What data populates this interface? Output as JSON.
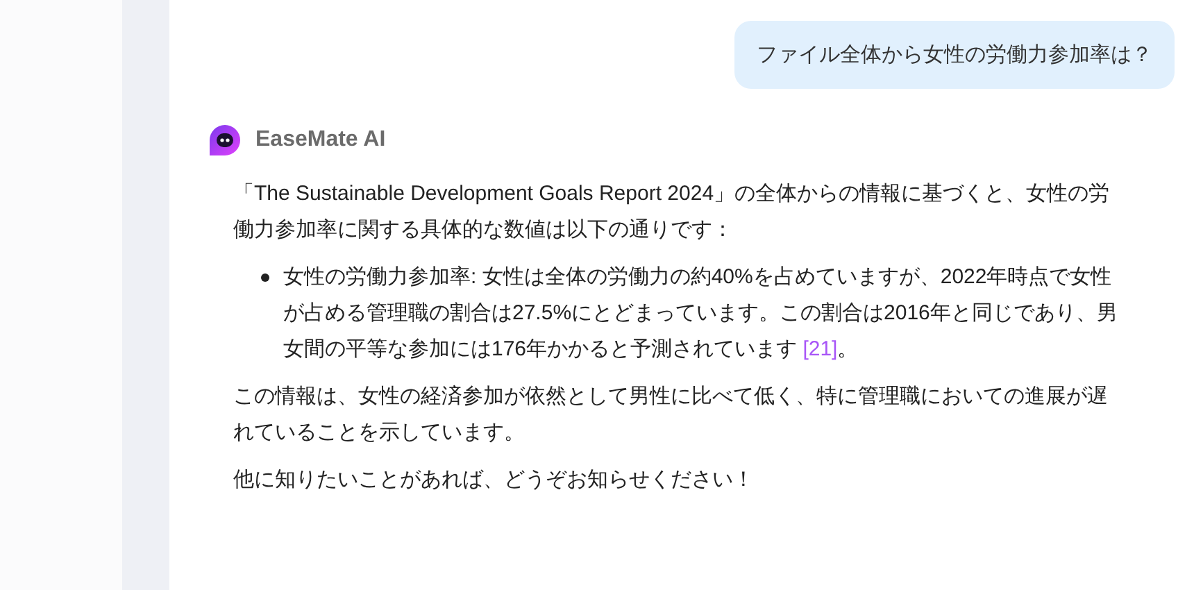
{
  "user_message": "ファイル全体から女性の労働力参加率は？",
  "assistant": {
    "name": "EaseMate AI",
    "intro": "「The Sustainable Development Goals Report 2024」の全体からの情報に基づくと、女性の労働力参加率に関する具体的な数値は以下の通りです：",
    "bullets": [
      {
        "text": "女性の労働力参加率: 女性は全体の労働力の約40%を占めていますが、2022年時点で女性が占める管理職の割合は27.5%にとどまっています。この割合は2016年と同じであり、男女間の平等な参加には176年かかると予測されています",
        "reference": "[21]",
        "end": "。"
      }
    ],
    "paragraphs": [
      "この情報は、女性の経済参加が依然として男性に比べて低く、特に管理職においての進展が遅れていることを示しています。",
      "他に知りたいことがあれば、どうぞお知らせください！"
    ]
  }
}
